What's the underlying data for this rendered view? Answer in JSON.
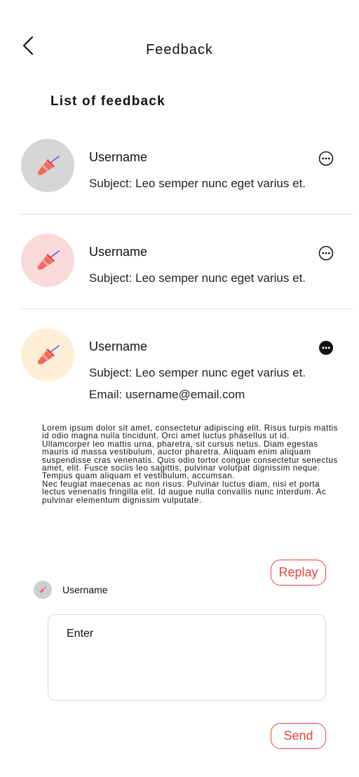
{
  "header": {
    "title": "Feedback",
    "back_icon": "chevron-left-icon"
  },
  "section": {
    "title": "List of feedback"
  },
  "feedbacks": [
    {
      "username": "Username",
      "subject": "Subject: Leo semper nunc eget varius et.",
      "avatar_bg": "#d6d6d6",
      "more_icon": "more-horizontal-outline-icon"
    },
    {
      "username": "Username",
      "subject": "Subject: Leo semper nunc eget varius et.",
      "avatar_bg": "#f9d9db",
      "more_icon": "more-horizontal-outline-icon"
    },
    {
      "username": "Username",
      "subject": "Subject: Leo semper nunc eget varius et.",
      "email": "Email: username@email.com",
      "avatar_bg": "#fcefd6",
      "more_icon": "more-horizontal-filled-icon"
    }
  ],
  "detail": {
    "body": "Lorem ipsum dolor sit amet, consectetur adipiscing elit. Risus turpis mattis id odio magna nulla tincidunt. Orci amet luctus phasellus ut id. Ullamcorper leo mattis urna, pharetra, sit cursus netus. Diam egestas mauris id massa vestibulum, auctor pharetra. Aliquam enim aliquam suspendisse cras venenatis. Quis odio tortor congue consectetur senectus amet, elit. Fusce sociis leo sagittis, pulvinar volutpat dignissim neque. Tempus quam aliquam et vestibulum, accumsan.\nNec feugiat maecenas ac non risus. Pulvinar luctus diam, nisi et porta lectus venenatis fringilla elit. Id augue nulla convallis nunc interdum. Ac pulvinar elementum dignissim vulputate."
  },
  "reply": {
    "replay_label": "Replay",
    "username": "Username",
    "placeholder": "Enter",
    "send_label": "Send"
  },
  "colors": {
    "accent": "#e8453c",
    "divider": "#e3e3e3",
    "border": "#d9d9d9"
  }
}
